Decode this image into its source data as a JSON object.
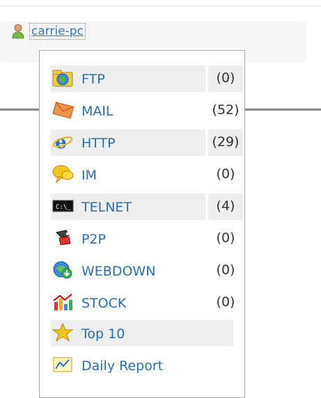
{
  "user": {
    "name": "carrie-pc",
    "icon": "user-icon"
  },
  "menu": {
    "items": [
      {
        "label": "FTP",
        "count": "(0)",
        "icon": "ftp-globe-folder-icon",
        "highlight": true
      },
      {
        "label": "MAIL",
        "count": "(52)",
        "icon": "mail-envelope-icon",
        "highlight": false
      },
      {
        "label": "HTTP",
        "count": "(29)",
        "icon": "http-browser-icon",
        "highlight": true
      },
      {
        "label": "IM",
        "count": "(0)",
        "icon": "im-chat-bubble-icon",
        "highlight": false
      },
      {
        "label": "TELNET",
        "count": "(4)",
        "icon": "telnet-terminal-icon",
        "highlight": true
      },
      {
        "label": "P2P",
        "count": "(0)",
        "icon": "p2p-icon",
        "highlight": false
      },
      {
        "label": "WEBDOWN",
        "count": "(0)",
        "icon": "webdown-download-icon",
        "highlight": false
      },
      {
        "label": "STOCK",
        "count": "(0)",
        "icon": "stock-chart-icon",
        "highlight": false
      },
      {
        "label": "Top 10",
        "count": "",
        "icon": "star-icon",
        "highlight": true
      },
      {
        "label": "Daily Report",
        "count": "",
        "icon": "report-chart-icon",
        "highlight": false
      }
    ]
  },
  "colors": {
    "link": "#2e6ea7",
    "highlight": "#eeeeee",
    "border": "#a8a8a8"
  }
}
